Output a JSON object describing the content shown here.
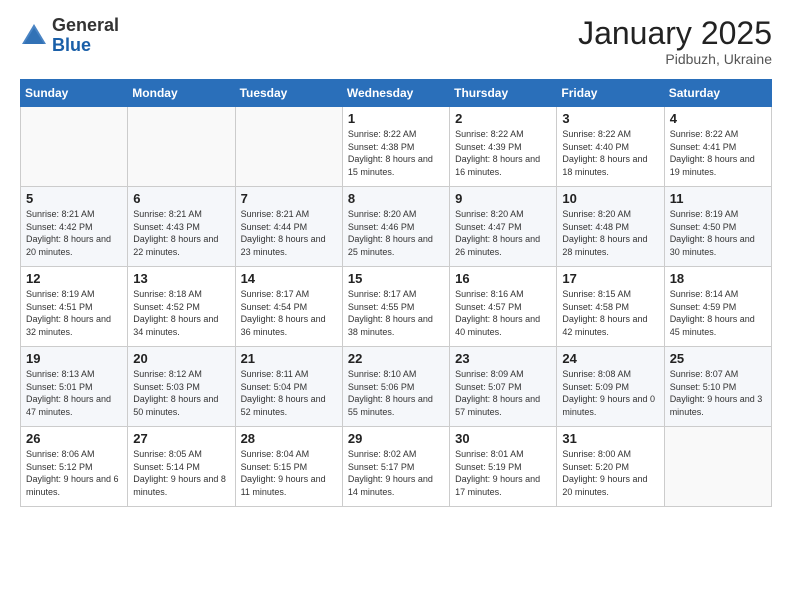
{
  "logo": {
    "general": "General",
    "blue": "Blue"
  },
  "header": {
    "month": "January 2025",
    "location": "Pidbuzh, Ukraine"
  },
  "weekdays": [
    "Sunday",
    "Monday",
    "Tuesday",
    "Wednesday",
    "Thursday",
    "Friday",
    "Saturday"
  ],
  "weeks": [
    [
      {
        "day": "",
        "sunrise": "",
        "sunset": "",
        "daylight": ""
      },
      {
        "day": "",
        "sunrise": "",
        "sunset": "",
        "daylight": ""
      },
      {
        "day": "",
        "sunrise": "",
        "sunset": "",
        "daylight": ""
      },
      {
        "day": "1",
        "sunrise": "Sunrise: 8:22 AM",
        "sunset": "Sunset: 4:38 PM",
        "daylight": "Daylight: 8 hours and 15 minutes."
      },
      {
        "day": "2",
        "sunrise": "Sunrise: 8:22 AM",
        "sunset": "Sunset: 4:39 PM",
        "daylight": "Daylight: 8 hours and 16 minutes."
      },
      {
        "day": "3",
        "sunrise": "Sunrise: 8:22 AM",
        "sunset": "Sunset: 4:40 PM",
        "daylight": "Daylight: 8 hours and 18 minutes."
      },
      {
        "day": "4",
        "sunrise": "Sunrise: 8:22 AM",
        "sunset": "Sunset: 4:41 PM",
        "daylight": "Daylight: 8 hours and 19 minutes."
      }
    ],
    [
      {
        "day": "5",
        "sunrise": "Sunrise: 8:21 AM",
        "sunset": "Sunset: 4:42 PM",
        "daylight": "Daylight: 8 hours and 20 minutes."
      },
      {
        "day": "6",
        "sunrise": "Sunrise: 8:21 AM",
        "sunset": "Sunset: 4:43 PM",
        "daylight": "Daylight: 8 hours and 22 minutes."
      },
      {
        "day": "7",
        "sunrise": "Sunrise: 8:21 AM",
        "sunset": "Sunset: 4:44 PM",
        "daylight": "Daylight: 8 hours and 23 minutes."
      },
      {
        "day": "8",
        "sunrise": "Sunrise: 8:20 AM",
        "sunset": "Sunset: 4:46 PM",
        "daylight": "Daylight: 8 hours and 25 minutes."
      },
      {
        "day": "9",
        "sunrise": "Sunrise: 8:20 AM",
        "sunset": "Sunset: 4:47 PM",
        "daylight": "Daylight: 8 hours and 26 minutes."
      },
      {
        "day": "10",
        "sunrise": "Sunrise: 8:20 AM",
        "sunset": "Sunset: 4:48 PM",
        "daylight": "Daylight: 8 hours and 28 minutes."
      },
      {
        "day": "11",
        "sunrise": "Sunrise: 8:19 AM",
        "sunset": "Sunset: 4:50 PM",
        "daylight": "Daylight: 8 hours and 30 minutes."
      }
    ],
    [
      {
        "day": "12",
        "sunrise": "Sunrise: 8:19 AM",
        "sunset": "Sunset: 4:51 PM",
        "daylight": "Daylight: 8 hours and 32 minutes."
      },
      {
        "day": "13",
        "sunrise": "Sunrise: 8:18 AM",
        "sunset": "Sunset: 4:52 PM",
        "daylight": "Daylight: 8 hours and 34 minutes."
      },
      {
        "day": "14",
        "sunrise": "Sunrise: 8:17 AM",
        "sunset": "Sunset: 4:54 PM",
        "daylight": "Daylight: 8 hours and 36 minutes."
      },
      {
        "day": "15",
        "sunrise": "Sunrise: 8:17 AM",
        "sunset": "Sunset: 4:55 PM",
        "daylight": "Daylight: 8 hours and 38 minutes."
      },
      {
        "day": "16",
        "sunrise": "Sunrise: 8:16 AM",
        "sunset": "Sunset: 4:57 PM",
        "daylight": "Daylight: 8 hours and 40 minutes."
      },
      {
        "day": "17",
        "sunrise": "Sunrise: 8:15 AM",
        "sunset": "Sunset: 4:58 PM",
        "daylight": "Daylight: 8 hours and 42 minutes."
      },
      {
        "day": "18",
        "sunrise": "Sunrise: 8:14 AM",
        "sunset": "Sunset: 4:59 PM",
        "daylight": "Daylight: 8 hours and 45 minutes."
      }
    ],
    [
      {
        "day": "19",
        "sunrise": "Sunrise: 8:13 AM",
        "sunset": "Sunset: 5:01 PM",
        "daylight": "Daylight: 8 hours and 47 minutes."
      },
      {
        "day": "20",
        "sunrise": "Sunrise: 8:12 AM",
        "sunset": "Sunset: 5:03 PM",
        "daylight": "Daylight: 8 hours and 50 minutes."
      },
      {
        "day": "21",
        "sunrise": "Sunrise: 8:11 AM",
        "sunset": "Sunset: 5:04 PM",
        "daylight": "Daylight: 8 hours and 52 minutes."
      },
      {
        "day": "22",
        "sunrise": "Sunrise: 8:10 AM",
        "sunset": "Sunset: 5:06 PM",
        "daylight": "Daylight: 8 hours and 55 minutes."
      },
      {
        "day": "23",
        "sunrise": "Sunrise: 8:09 AM",
        "sunset": "Sunset: 5:07 PM",
        "daylight": "Daylight: 8 hours and 57 minutes."
      },
      {
        "day": "24",
        "sunrise": "Sunrise: 8:08 AM",
        "sunset": "Sunset: 5:09 PM",
        "daylight": "Daylight: 9 hours and 0 minutes."
      },
      {
        "day": "25",
        "sunrise": "Sunrise: 8:07 AM",
        "sunset": "Sunset: 5:10 PM",
        "daylight": "Daylight: 9 hours and 3 minutes."
      }
    ],
    [
      {
        "day": "26",
        "sunrise": "Sunrise: 8:06 AM",
        "sunset": "Sunset: 5:12 PM",
        "daylight": "Daylight: 9 hours and 6 minutes."
      },
      {
        "day": "27",
        "sunrise": "Sunrise: 8:05 AM",
        "sunset": "Sunset: 5:14 PM",
        "daylight": "Daylight: 9 hours and 8 minutes."
      },
      {
        "day": "28",
        "sunrise": "Sunrise: 8:04 AM",
        "sunset": "Sunset: 5:15 PM",
        "daylight": "Daylight: 9 hours and 11 minutes."
      },
      {
        "day": "29",
        "sunrise": "Sunrise: 8:02 AM",
        "sunset": "Sunset: 5:17 PM",
        "daylight": "Daylight: 9 hours and 14 minutes."
      },
      {
        "day": "30",
        "sunrise": "Sunrise: 8:01 AM",
        "sunset": "Sunset: 5:19 PM",
        "daylight": "Daylight: 9 hours and 17 minutes."
      },
      {
        "day": "31",
        "sunrise": "Sunrise: 8:00 AM",
        "sunset": "Sunset: 5:20 PM",
        "daylight": "Daylight: 9 hours and 20 minutes."
      },
      {
        "day": "",
        "sunrise": "",
        "sunset": "",
        "daylight": ""
      }
    ]
  ]
}
